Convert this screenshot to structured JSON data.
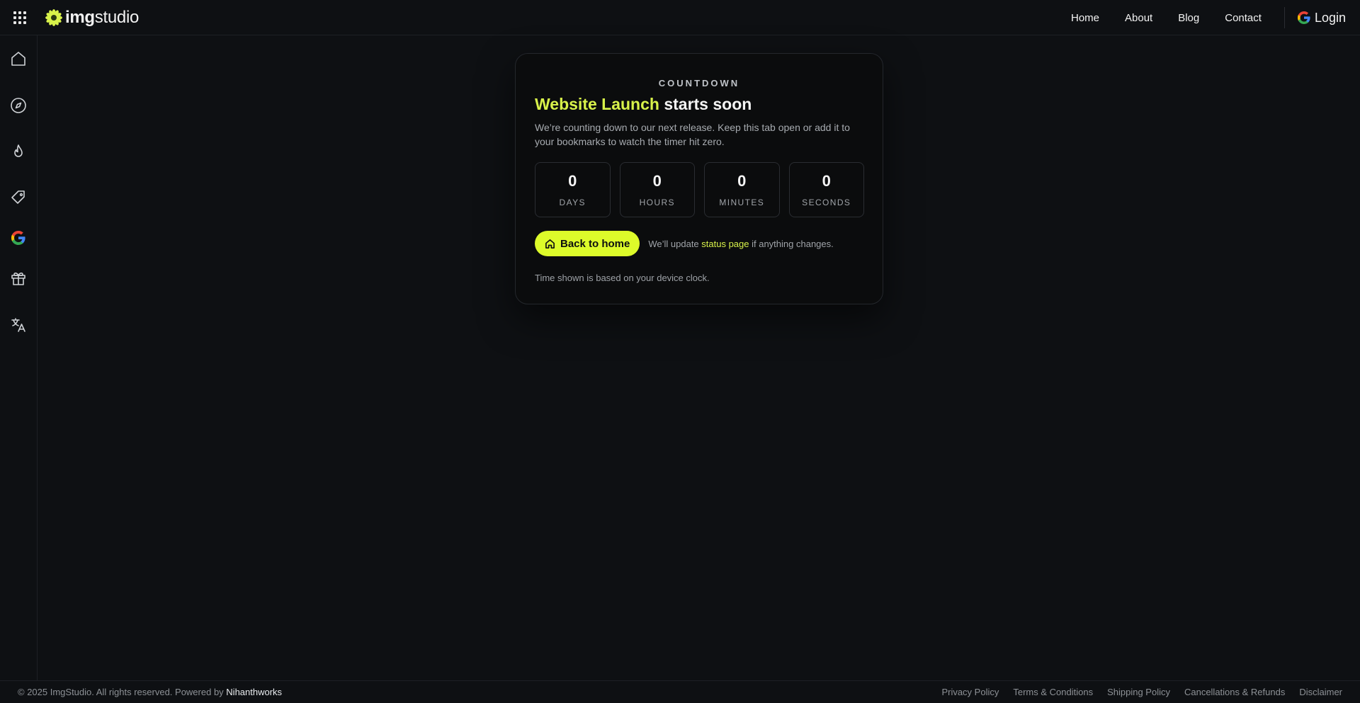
{
  "header": {
    "logo_text_bold": "img",
    "logo_text_light": "studio",
    "nav": [
      "Home",
      "About",
      "Blog",
      "Contact"
    ],
    "login_label": "Login"
  },
  "sidebar": {
    "icons": [
      "home-icon",
      "compass-icon",
      "flame-icon",
      "tag-icon",
      "google-icon",
      "gift-icon",
      "translate-icon"
    ]
  },
  "card": {
    "eyebrow": "COUNTDOWN",
    "title_accent": "Website Launch",
    "title_rest": " starts soon",
    "description": "We’re counting down to our next release. Keep this tab open or add it to your bookmarks to watch the timer hit zero.",
    "timer": [
      {
        "value": "0",
        "label": "DAYS"
      },
      {
        "value": "0",
        "label": "HOURS"
      },
      {
        "value": "0",
        "label": "MINUTES"
      },
      {
        "value": "0",
        "label": "SECONDS"
      }
    ],
    "home_button": "Back to home",
    "note_prefix": "We’ll update ",
    "note_link": "status page",
    "note_suffix": " if anything changes.",
    "footnote": "Time shown is based on your device clock."
  },
  "footer": {
    "copyright": "© 2025 ImgStudio. All rights reserved. Powered by ",
    "powered_by": "Nihanthworks",
    "links": [
      "Privacy Policy",
      "Terms & Conditions",
      "Shipping Policy",
      "Cancellations & Refunds",
      "Disclaimer"
    ]
  },
  "colors": {
    "accent": "#d8f24a",
    "button": "#ddfb2a",
    "background": "#0e1013"
  }
}
